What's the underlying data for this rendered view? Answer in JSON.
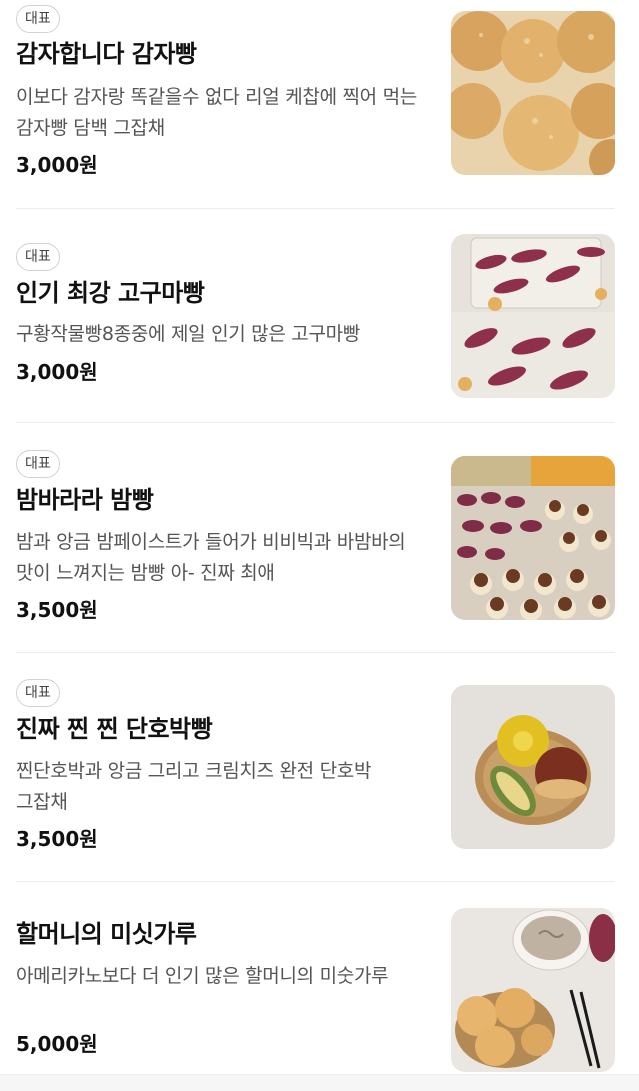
{
  "menu": {
    "items": [
      {
        "badge": "대표",
        "name": "감자합니다 감자빵",
        "description": "이보다 감자랑 똑같을수 없다 리얼 케찹에 찍어 먹는 감자빵 담백 그잡채",
        "price": "3,000원",
        "image": "potato-bread-photo"
      },
      {
        "badge": "대표",
        "name": "인기 최강 고구마빵",
        "description": "구황작물빵8종중에 제일 인기 많은 고구마빵",
        "price": "3,000원",
        "image": "sweet-potato-bread-photo"
      },
      {
        "badge": "대표",
        "name": "밤바라라 밤빵",
        "description": "밤과 앙금 밤페이스트가 들어가 비비빅과 바밤바의 맛이 느껴지는 밤빵 아- 진짜 최애",
        "price": "3,500원",
        "image": "chestnut-bread-photo"
      },
      {
        "badge": "대표",
        "name": "진짜 찐 찐 단호박빵",
        "description": "찐단호박과 앙금 그리고 크림치즈 완전 단호박 그잡채",
        "price": "3,500원",
        "image": "pumpkin-bread-photo"
      },
      {
        "name": "할머니의 미싯가루",
        "description": "아메리카노보다 더 인기 많은 할머니의 미숫가루",
        "price": "5,000원",
        "image": "misutgaru-drink-photo"
      }
    ]
  }
}
